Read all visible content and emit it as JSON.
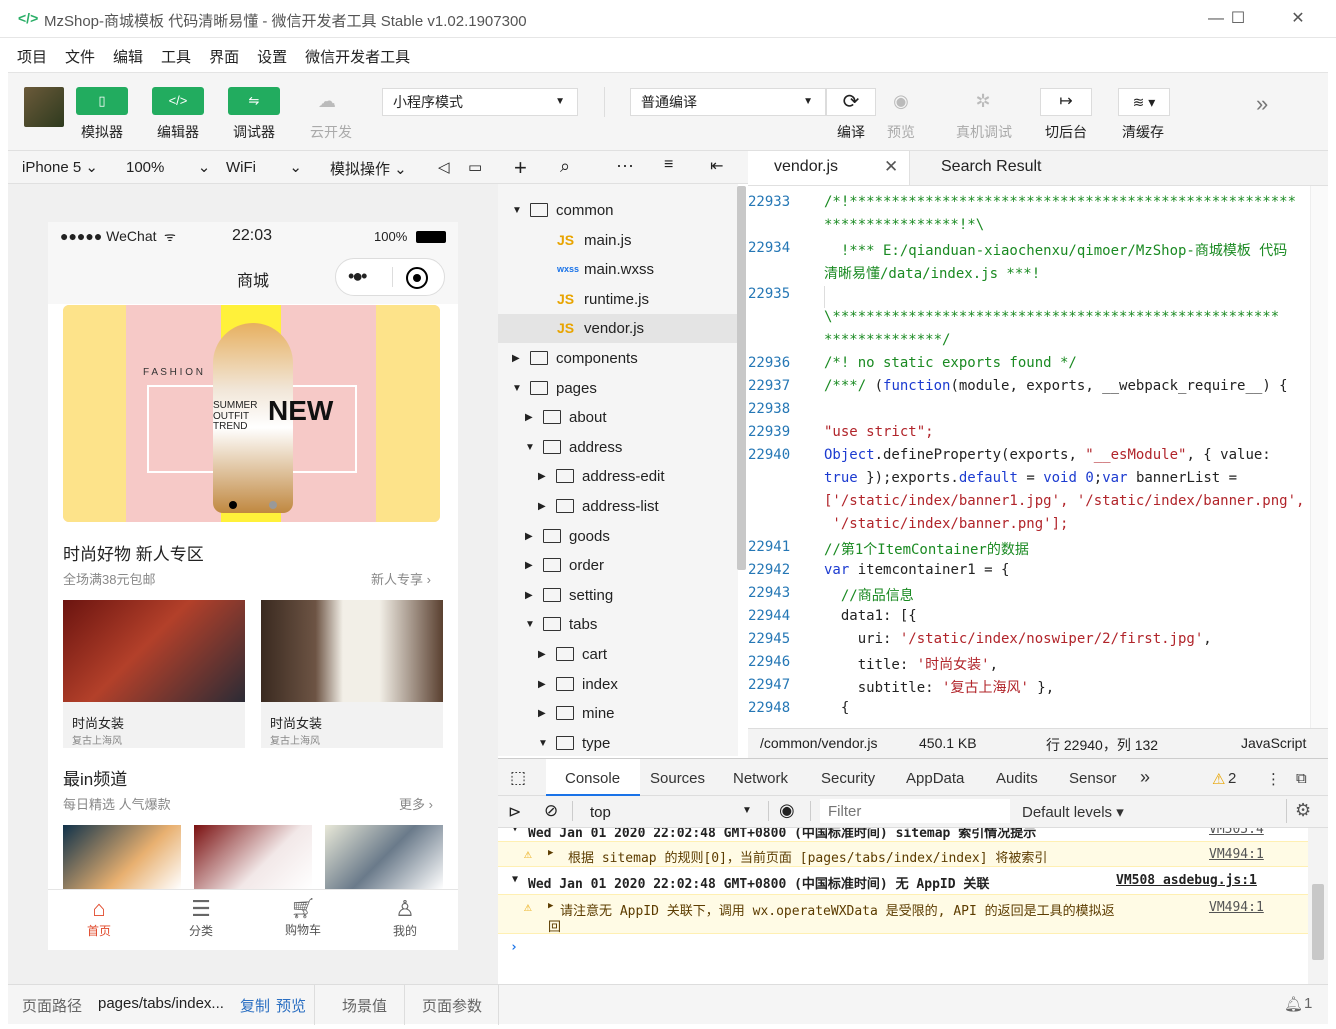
{
  "window": {
    "title": "MzShop-商城模板 代码清晰易懂 - 微信开发者工具 Stable v1.02.1907300",
    "logo": "</>"
  },
  "menu": [
    "项目",
    "文件",
    "编辑",
    "工具",
    "界面",
    "设置",
    "微信开发者工具"
  ],
  "toolbar": {
    "simulator": "模拟器",
    "editor": "编辑器",
    "debugger": "调试器",
    "cloud": "云开发",
    "mode": "小程序模式",
    "compile_mode": "普通编译",
    "compile": "编译",
    "preview": "预览",
    "remote_debug": "真机调试",
    "background": "切后台",
    "clear_cache": "清缓存"
  },
  "devbar": {
    "device": "iPhone 5",
    "zoom": "100%",
    "network": "WiFi",
    "sim_ops": "模拟操作"
  },
  "phone": {
    "status": {
      "carrier": "●●●●● WeChat",
      "time": "22:03",
      "battery": "100%"
    },
    "nav_title": "商城",
    "banner": {
      "line1": "SUMMER",
      "line2": "OUTFIT",
      "line3": "TREND",
      "big": "NEW",
      "fashion": "F A S H I O N"
    },
    "section1": {
      "title": "时尚好物 新人专区",
      "sub": "全场满38元包邮",
      "more": "新人专享"
    },
    "cards": [
      {
        "title": "时尚女装",
        "sub": "复古上海风"
      },
      {
        "title": "时尚女装",
        "sub": "复古上海风"
      }
    ],
    "section2": {
      "title": "最in频道",
      "sub": "每日精选 人气爆款",
      "more": "更多"
    },
    "tabs": [
      {
        "label": "首页"
      },
      {
        "label": "分类"
      },
      {
        "label": "购物车"
      },
      {
        "label": "我的"
      }
    ]
  },
  "tree": [
    {
      "label": "common",
      "depth": 0,
      "type": "folder-open"
    },
    {
      "label": "main.js",
      "depth": 1,
      "type": "js",
      "badge": "JS"
    },
    {
      "label": "main.wxss",
      "depth": 1,
      "type": "wxss",
      "badge": "wxss"
    },
    {
      "label": "runtime.js",
      "depth": 1,
      "type": "js",
      "badge": "JS"
    },
    {
      "label": "vendor.js",
      "depth": 1,
      "type": "js",
      "badge": "JS",
      "selected": true
    },
    {
      "label": "components",
      "depth": 0,
      "type": "folder"
    },
    {
      "label": "pages",
      "depth": 0,
      "type": "folder-open"
    },
    {
      "label": "about",
      "depth": 1,
      "type": "folder"
    },
    {
      "label": "address",
      "depth": 1,
      "type": "folder-open"
    },
    {
      "label": "address-edit",
      "depth": 2,
      "type": "folder"
    },
    {
      "label": "address-list",
      "depth": 2,
      "type": "folder"
    },
    {
      "label": "goods",
      "depth": 1,
      "type": "folder"
    },
    {
      "label": "order",
      "depth": 1,
      "type": "folder"
    },
    {
      "label": "setting",
      "depth": 1,
      "type": "folder"
    },
    {
      "label": "tabs",
      "depth": 1,
      "type": "folder-open"
    },
    {
      "label": "cart",
      "depth": 2,
      "type": "folder"
    },
    {
      "label": "index",
      "depth": 2,
      "type": "folder"
    },
    {
      "label": "mine",
      "depth": 2,
      "type": "folder"
    },
    {
      "label": "type",
      "depth": 2,
      "type": "folder-open"
    }
  ],
  "editor_tabs": {
    "active": "vendor.js",
    "other": "Search Result"
  },
  "code": [
    {
      "n": "22933",
      "t": "/*!*****************************************************",
      "c": "cm"
    },
    {
      "n": "",
      "t": "****************!*\\",
      "c": "cm"
    },
    {
      "n": "22934",
      "t": "  !*** E:/qianduan-xiaochenxu/qimoer/MzShop-商城模板 代码",
      "c": "cm"
    },
    {
      "n": "",
      "t": "清晰易懂/data/index.js ***!",
      "c": "cm"
    },
    {
      "n": "22935",
      "t": "",
      "c": "cm"
    },
    {
      "n": "",
      "t": "\\*****************************************************",
      "c": "cm"
    },
    {
      "n": "",
      "t": "**************/",
      "c": "cm"
    },
    {
      "n": "22936",
      "t": "/*! no static exports found */",
      "c": "cm"
    },
    {
      "n": "22937",
      "t": "/***/ (function(module, exports, __webpack_require__) {",
      "c": "mix1"
    },
    {
      "n": "22938",
      "t": "",
      "c": ""
    },
    {
      "n": "22939",
      "t": "\"use strict\";",
      "c": "st"
    },
    {
      "n": "22940",
      "t": "Object.defineProperty(exports, \"__esModule\", { value:",
      "c": "mix2"
    },
    {
      "n": "",
      "t": "true });exports.default = void 0;var bannerList =",
      "c": "mix3"
    },
    {
      "n": "",
      "t": "['/static/index/banner1.jpg', '/static/index/banner.png',",
      "c": "st"
    },
    {
      "n": "",
      "t": " '/static/index/banner.png'];",
      "c": "st"
    },
    {
      "n": "22941",
      "t": "//第1个ItemContainer的数据",
      "c": "cm"
    },
    {
      "n": "22942",
      "t": "var itemcontainer1 = {",
      "c": "mix4"
    },
    {
      "n": "22943",
      "t": "  //商品信息",
      "c": "cm"
    },
    {
      "n": "22944",
      "t": "  data1: [{",
      "c": ""
    },
    {
      "n": "22945",
      "t": "    uri: '/static/index/noswiper/2/first.jpg',",
      "c": "mix5"
    },
    {
      "n": "22946",
      "t": "    title: '时尚女装',",
      "c": "mix5"
    },
    {
      "n": "22947",
      "t": "    subtitle: '复古上海风' },",
      "c": "mix5"
    },
    {
      "n": "22948",
      "t": "  {",
      "c": ""
    }
  ],
  "status": {
    "path": "/common/vendor.js",
    "size": "450.1 KB",
    "pos": "行 22940，列 132",
    "lang": "JavaScript"
  },
  "devtools": {
    "tabs": [
      "Console",
      "Sources",
      "Network",
      "Security",
      "AppData",
      "Audits",
      "Sensor"
    ],
    "active": "Console",
    "warn_count": "2",
    "context": "top",
    "filter_placeholder": "Filter",
    "levels": "Default levels"
  },
  "console": [
    {
      "kind": "group",
      "text": "Wed Jan 01 2020 22:02:48 GMT+0800 (中国标准时间) sitemap 索引情况提示",
      "src": "VM505:4"
    },
    {
      "kind": "warn",
      "text": "根据 sitemap 的规则[0]，当前页面 [pages/tabs/index/index] 将被索引",
      "src": "VM494:1"
    },
    {
      "kind": "group",
      "text": "Wed Jan 01 2020 22:02:48 GMT+0800 (中国标准时间) 无 AppID 关联",
      "src": "VM508 asdebug.js:1"
    },
    {
      "kind": "warn",
      "text": "请注意无 AppID 关联下，调用 wx.operateWXData 是受限的, API 的返回是工具的模拟返",
      "text2": "回",
      "src": "VM494:1"
    }
  ],
  "bottom": {
    "path_label": "页面路径",
    "path": "pages/tabs/index...",
    "copy": "复制",
    "preview": "预览",
    "scene": "场景值",
    "params": "页面参数",
    "notif": "1"
  }
}
